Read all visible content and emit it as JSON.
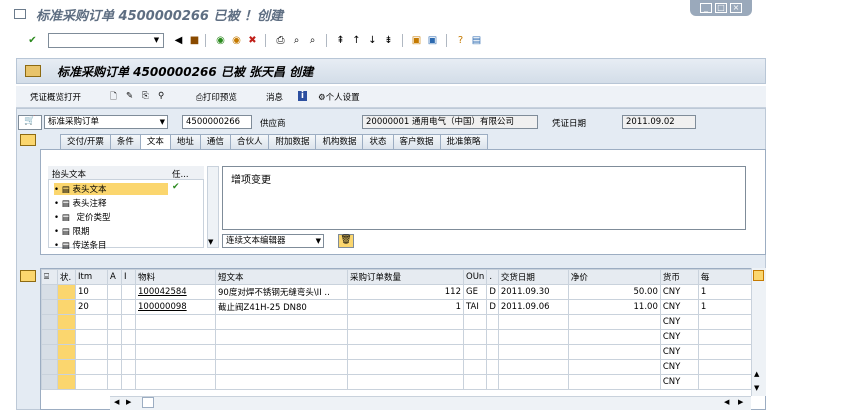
{
  "window": {
    "title": "标准采购订单 4500000266 已被 ！创建"
  },
  "header": {
    "title": "标准采购订单 4500000266 已被 张天昌 创建"
  },
  "appbar": {
    "items": [
      "凭证概览打开",
      "打印预览",
      "消息",
      "个人设置"
    ]
  },
  "docline": {
    "doc_type": "标准采购订单",
    "po_number": "4500000266",
    "vendor_label": "供应商",
    "vendor_value": "20000001 通用电气（中国）有限公司",
    "date_label": "凭证日期",
    "date_value": "2011.09.02"
  },
  "tabs": [
    "交付/开票",
    "条件",
    "文本",
    "地址",
    "通信",
    "合伙人",
    "附加数据",
    "机构数据",
    "状态",
    "客户数据",
    "批准策略"
  ],
  "active_tab": "文本",
  "texts": {
    "col_header": "抬头文本",
    "col_flag": "任...",
    "items": [
      "表头文本",
      "表头注释",
      "定价类型",
      "限期",
      "传送条目"
    ],
    "editor_content": "增项变更",
    "editor_select": "连续文本编辑器"
  },
  "grid": {
    "headers": [
      "状.",
      "Itm",
      "A",
      "I",
      "物料",
      "短文本",
      "采购订单数量",
      "OUn",
      ".",
      "交货日期",
      "净价",
      "货币",
      "每"
    ],
    "rows": [
      {
        "itm": "10",
        "material": "100042584",
        "short": "90度对焊不锈钢无缝弯头\\II ..",
        "qty": "112",
        "oun": "GE",
        "d": "D",
        "date": "2011.09.30",
        "price": "50.00",
        "cur": "CNY",
        "per": "1"
      },
      {
        "itm": "20",
        "material": "100000098",
        "short": "截止阀Z41H-25 DN80",
        "qty": "1",
        "oun": "TAI",
        "d": "D",
        "date": "2011.09.06",
        "price": "11.00",
        "cur": "CNY",
        "per": "1"
      }
    ],
    "empty_cur": "CNY"
  },
  "colors": {
    "accent": "#fbd66e",
    "header_bg": "#d3dde8"
  }
}
